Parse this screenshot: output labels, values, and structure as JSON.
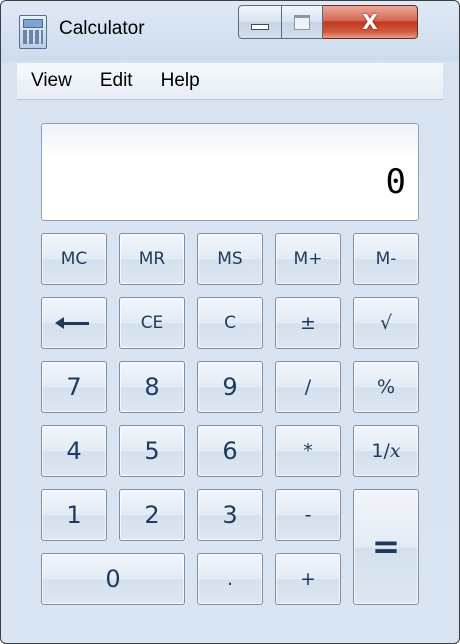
{
  "window": {
    "title": "Calculator",
    "close_glyph": "X"
  },
  "menu": [
    "View",
    "Edit",
    "Help"
  ],
  "display": {
    "value": "0"
  },
  "keys": {
    "mc": "MC",
    "mr": "MR",
    "ms": "MS",
    "mplus": "M+",
    "mminus": "M-",
    "ce": "CE",
    "c": "C",
    "plusminus": "±",
    "sqrt": "√",
    "seven": "7",
    "eight": "8",
    "nine": "9",
    "divide": "/",
    "percent": "%",
    "four": "4",
    "five": "5",
    "six": "6",
    "multiply": "*",
    "reciprocal_prefix": "1/",
    "reciprocal_var": "x",
    "one": "1",
    "two": "2",
    "three": "3",
    "minus": "-",
    "equals": "=",
    "zero": "0",
    "decimal": ".",
    "plus": "+"
  },
  "icons": {
    "app": "calculator-icon",
    "backspace": "backspace-arrow-icon"
  }
}
